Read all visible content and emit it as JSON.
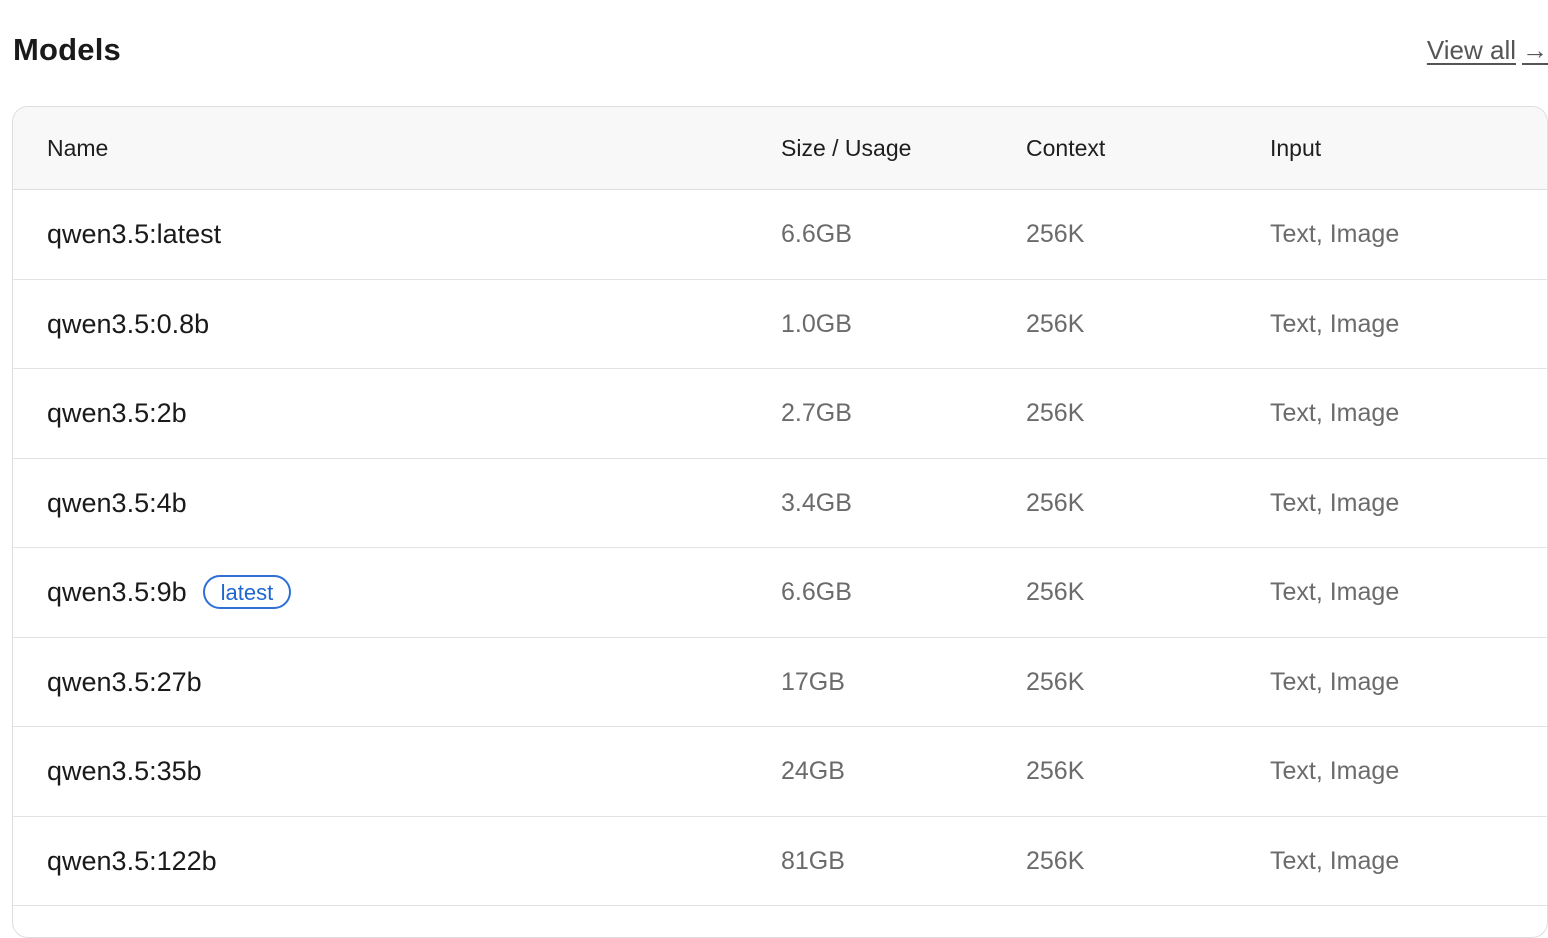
{
  "section": {
    "title": "Models",
    "view_all_label": "View all",
    "view_all_arrow": "→"
  },
  "table": {
    "columns": [
      "Name",
      "Size / Usage",
      "Context",
      "Input"
    ],
    "rows": [
      {
        "name": "qwen3.5:latest",
        "badge": "",
        "size": "6.6GB",
        "context": "256K",
        "input": "Text, Image"
      },
      {
        "name": "qwen3.5:0.8b",
        "badge": "",
        "size": "1.0GB",
        "context": "256K",
        "input": "Text, Image"
      },
      {
        "name": "qwen3.5:2b",
        "badge": "",
        "size": "2.7GB",
        "context": "256K",
        "input": "Text, Image"
      },
      {
        "name": "qwen3.5:4b",
        "badge": "",
        "size": "3.4GB",
        "context": "256K",
        "input": "Text, Image"
      },
      {
        "name": "qwen3.5:9b",
        "badge": "latest",
        "size": "6.6GB",
        "context": "256K",
        "input": "Text, Image"
      },
      {
        "name": "qwen3.5:27b",
        "badge": "",
        "size": "17GB",
        "context": "256K",
        "input": "Text, Image"
      },
      {
        "name": "qwen3.5:35b",
        "badge": "",
        "size": "24GB",
        "context": "256K",
        "input": "Text, Image"
      },
      {
        "name": "qwen3.5:122b",
        "badge": "",
        "size": "81GB",
        "context": "256K",
        "input": "Text, Image"
      }
    ]
  },
  "colors": {
    "badge_blue": "#1f66d1",
    "header_bg": "#f8f8f8",
    "muted_text": "#6b6b6b"
  }
}
